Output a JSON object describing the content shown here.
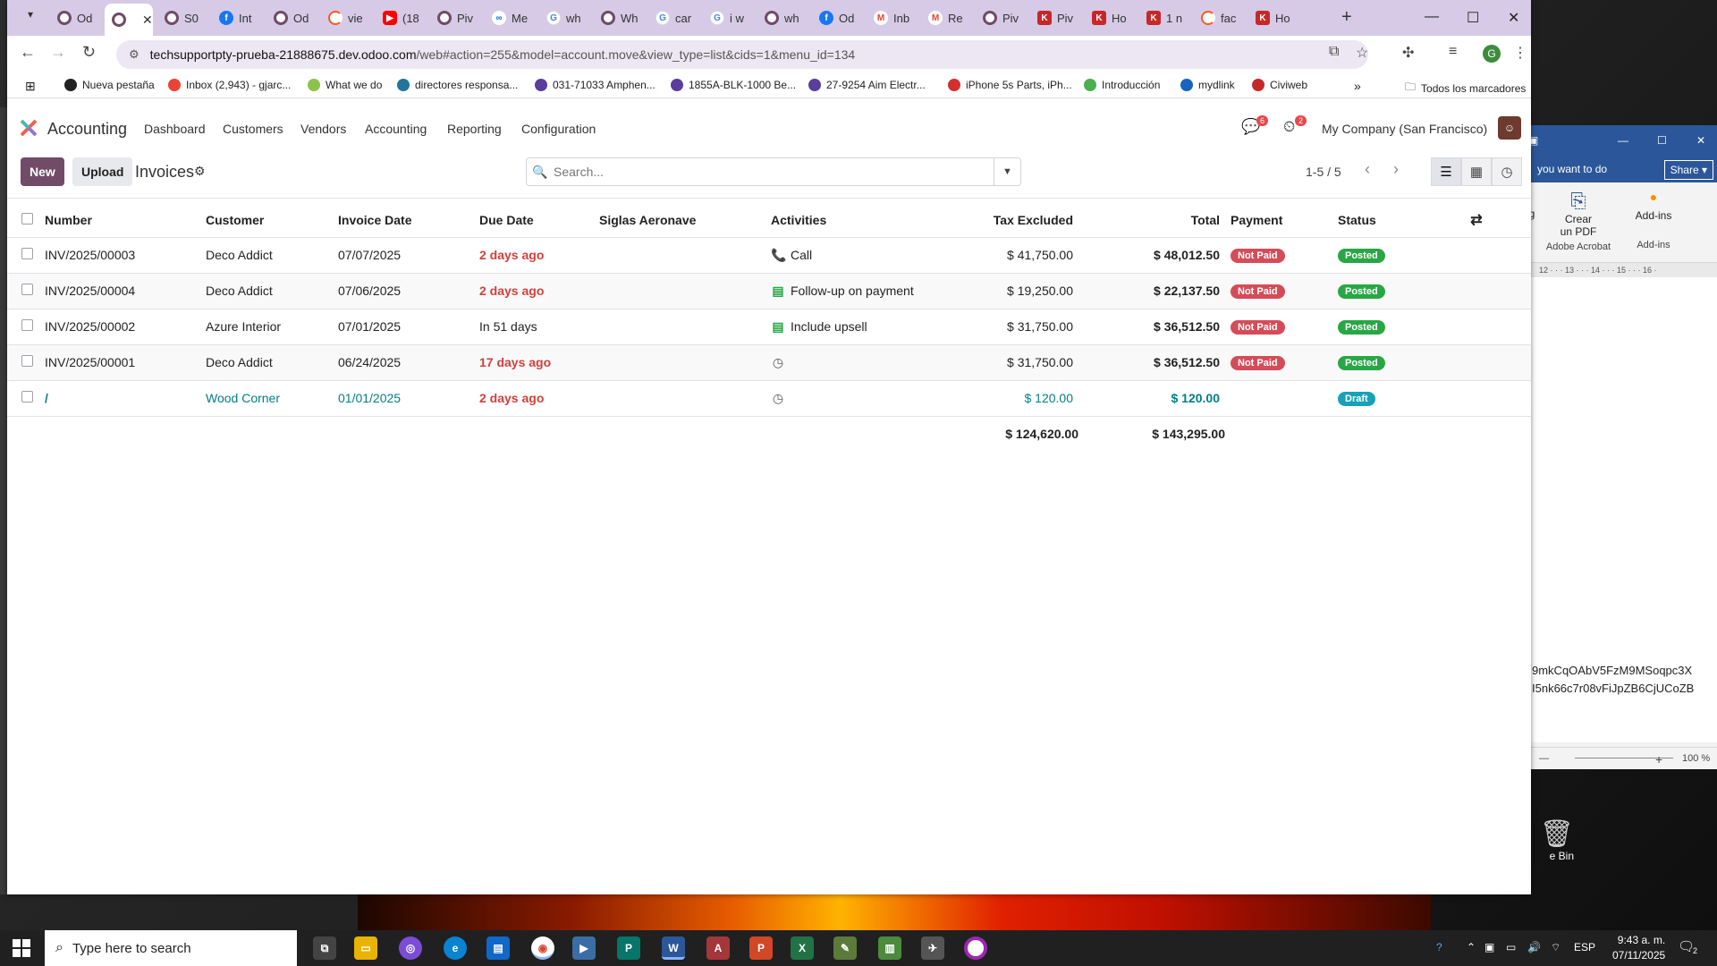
{
  "browser": {
    "tabs": [
      {
        "label": "Od",
        "icon": "odoo"
      },
      {
        "label": "",
        "icon": "odoo",
        "active": true
      },
      {
        "label": "S0",
        "icon": "odoo"
      },
      {
        "label": "Int",
        "icon": "facebook"
      },
      {
        "label": "Od",
        "icon": "odoo"
      },
      {
        "label": "vie",
        "icon": "loop"
      },
      {
        "label": "(18",
        "icon": "youtube"
      },
      {
        "label": "Piv",
        "icon": "odoo"
      },
      {
        "label": "Me",
        "icon": "meta"
      },
      {
        "label": "wh",
        "icon": "google"
      },
      {
        "label": "Wh",
        "icon": "odoo"
      },
      {
        "label": "car",
        "icon": "google"
      },
      {
        "label": "i w",
        "icon": "google"
      },
      {
        "label": "wh",
        "icon": "odoo"
      },
      {
        "label": "Od",
        "icon": "facebook"
      },
      {
        "label": "Inb",
        "icon": "gmail"
      },
      {
        "label": "Re",
        "icon": "gmail"
      },
      {
        "label": "Piv",
        "icon": "odoo"
      },
      {
        "label": "Piv",
        "icon": "red"
      },
      {
        "label": "Ho",
        "icon": "red"
      },
      {
        "label": "1 n",
        "icon": "red"
      },
      {
        "label": "fac",
        "icon": "loop"
      },
      {
        "label": "Ho",
        "icon": "red"
      }
    ],
    "url_host": "techsupportpty-prueba-21888675.dev.odoo.com",
    "url_path": "/web#action=255&model=account.move&view_type=list&cids=1&menu_id=134",
    "profile_initial": "G",
    "bookmarks": [
      "Nueva pestaña",
      "Inbox (2,943) - gjarc...",
      "What we do",
      "directores responsa...",
      "031-71033 Amphen...",
      "1855A-BLK-1000 Be...",
      "27-9254 Aim Electr...",
      "iPhone 5s Parts, iPh...",
      "Introducción",
      "mydlink",
      "Civiweb"
    ],
    "all_bookmarks": "Todos los marcadores"
  },
  "odoo": {
    "app_name": "Accounting",
    "menu": [
      "Dashboard",
      "Customers",
      "Vendors",
      "Accounting",
      "Reporting",
      "Configuration"
    ],
    "messages_count": "6",
    "activities_count": "2",
    "company": "My Company (San Francisco)",
    "new_label": "New",
    "upload_label": "Upload",
    "title": "Invoices",
    "search_placeholder": "Search...",
    "pager": "1-5 / 5",
    "columns": [
      "Number",
      "Customer",
      "Invoice Date",
      "Due Date",
      "Siglas Aeronave",
      "Activities",
      "Tax Excluded",
      "Total",
      "Payment",
      "Status"
    ],
    "rows": [
      {
        "number": "INV/2025/00003",
        "customer": "Deco Addict",
        "invoice_date": "07/07/2025",
        "due": "2 days ago",
        "due_state": "overdue",
        "siglas": "",
        "activity_icon": "phone-icon",
        "activity": "Call",
        "tax_excl": "$ 41,750.00",
        "total": "$ 48,012.50",
        "payment": "Not Paid",
        "status": "Posted"
      },
      {
        "number": "INV/2025/00004",
        "customer": "Deco Addict",
        "invoice_date": "07/06/2025",
        "due": "2 days ago",
        "due_state": "overdue",
        "siglas": "",
        "activity_icon": "todo-icon",
        "activity": "Follow-up on payment",
        "tax_excl": "$ 19,250.00",
        "total": "$ 22,137.50",
        "payment": "Not Paid",
        "status": "Posted"
      },
      {
        "number": "INV/2025/00002",
        "customer": "Azure Interior",
        "invoice_date": "07/01/2025",
        "due": "In 51 days",
        "due_state": "normal",
        "siglas": "",
        "activity_icon": "todo-icon",
        "activity": "Include upsell",
        "tax_excl": "$ 31,750.00",
        "total": "$ 36,512.50",
        "payment": "Not Paid",
        "status": "Posted"
      },
      {
        "number": "INV/2025/00001",
        "customer": "Deco Addict",
        "invoice_date": "06/24/2025",
        "due": "17 days ago",
        "due_state": "overdue",
        "siglas": "",
        "activity_icon": "clock-icon",
        "activity": "",
        "tax_excl": "$ 31,750.00",
        "total": "$ 36,512.50",
        "payment": "Not Paid",
        "status": "Posted"
      },
      {
        "number": "/",
        "customer": "Wood Corner",
        "invoice_date": "01/01/2025",
        "due": "2 days ago",
        "due_state": "overdue",
        "siglas": "",
        "activity_icon": "clock-icon",
        "activity": "",
        "tax_excl": "$ 120.00",
        "total": "$ 120.00",
        "payment": "",
        "status": "Draft"
      }
    ],
    "total_tax_excl": "$ 124,620.00",
    "total_total": "$ 143,295.00"
  },
  "word": {
    "tell_me": "you want to do",
    "share": "Share",
    "group1": "ng",
    "pdf_label_1": "Crear",
    "pdf_label_2": "un PDF",
    "pdf_group": "Adobe Acrobat",
    "addins_label": "Add-ins",
    "addins_group": "Add-ins",
    "ruler": "12 · · · 13 · · · 14 · · · 15 · · · 16 ·",
    "text_line_1": "9mkCqOAbV5FzM9MSoqpc3X",
    "text_line_2": "I5nk66c7r08vFiJpZB6CjUCoZB",
    "zoom": "100 %",
    "recycle_label": "e Bin"
  },
  "taskbar": {
    "search_placeholder": "Type here to search",
    "lang": "ESP",
    "time": "9:43 a. m.",
    "date": "07/11/2025",
    "notif_count": "2"
  },
  "colors": {
    "odoo_primary": "#714b67",
    "not_paid": "#d44c59",
    "posted": "#28a745",
    "draft": "#17a2b8",
    "overdue": "#d23f3a"
  }
}
